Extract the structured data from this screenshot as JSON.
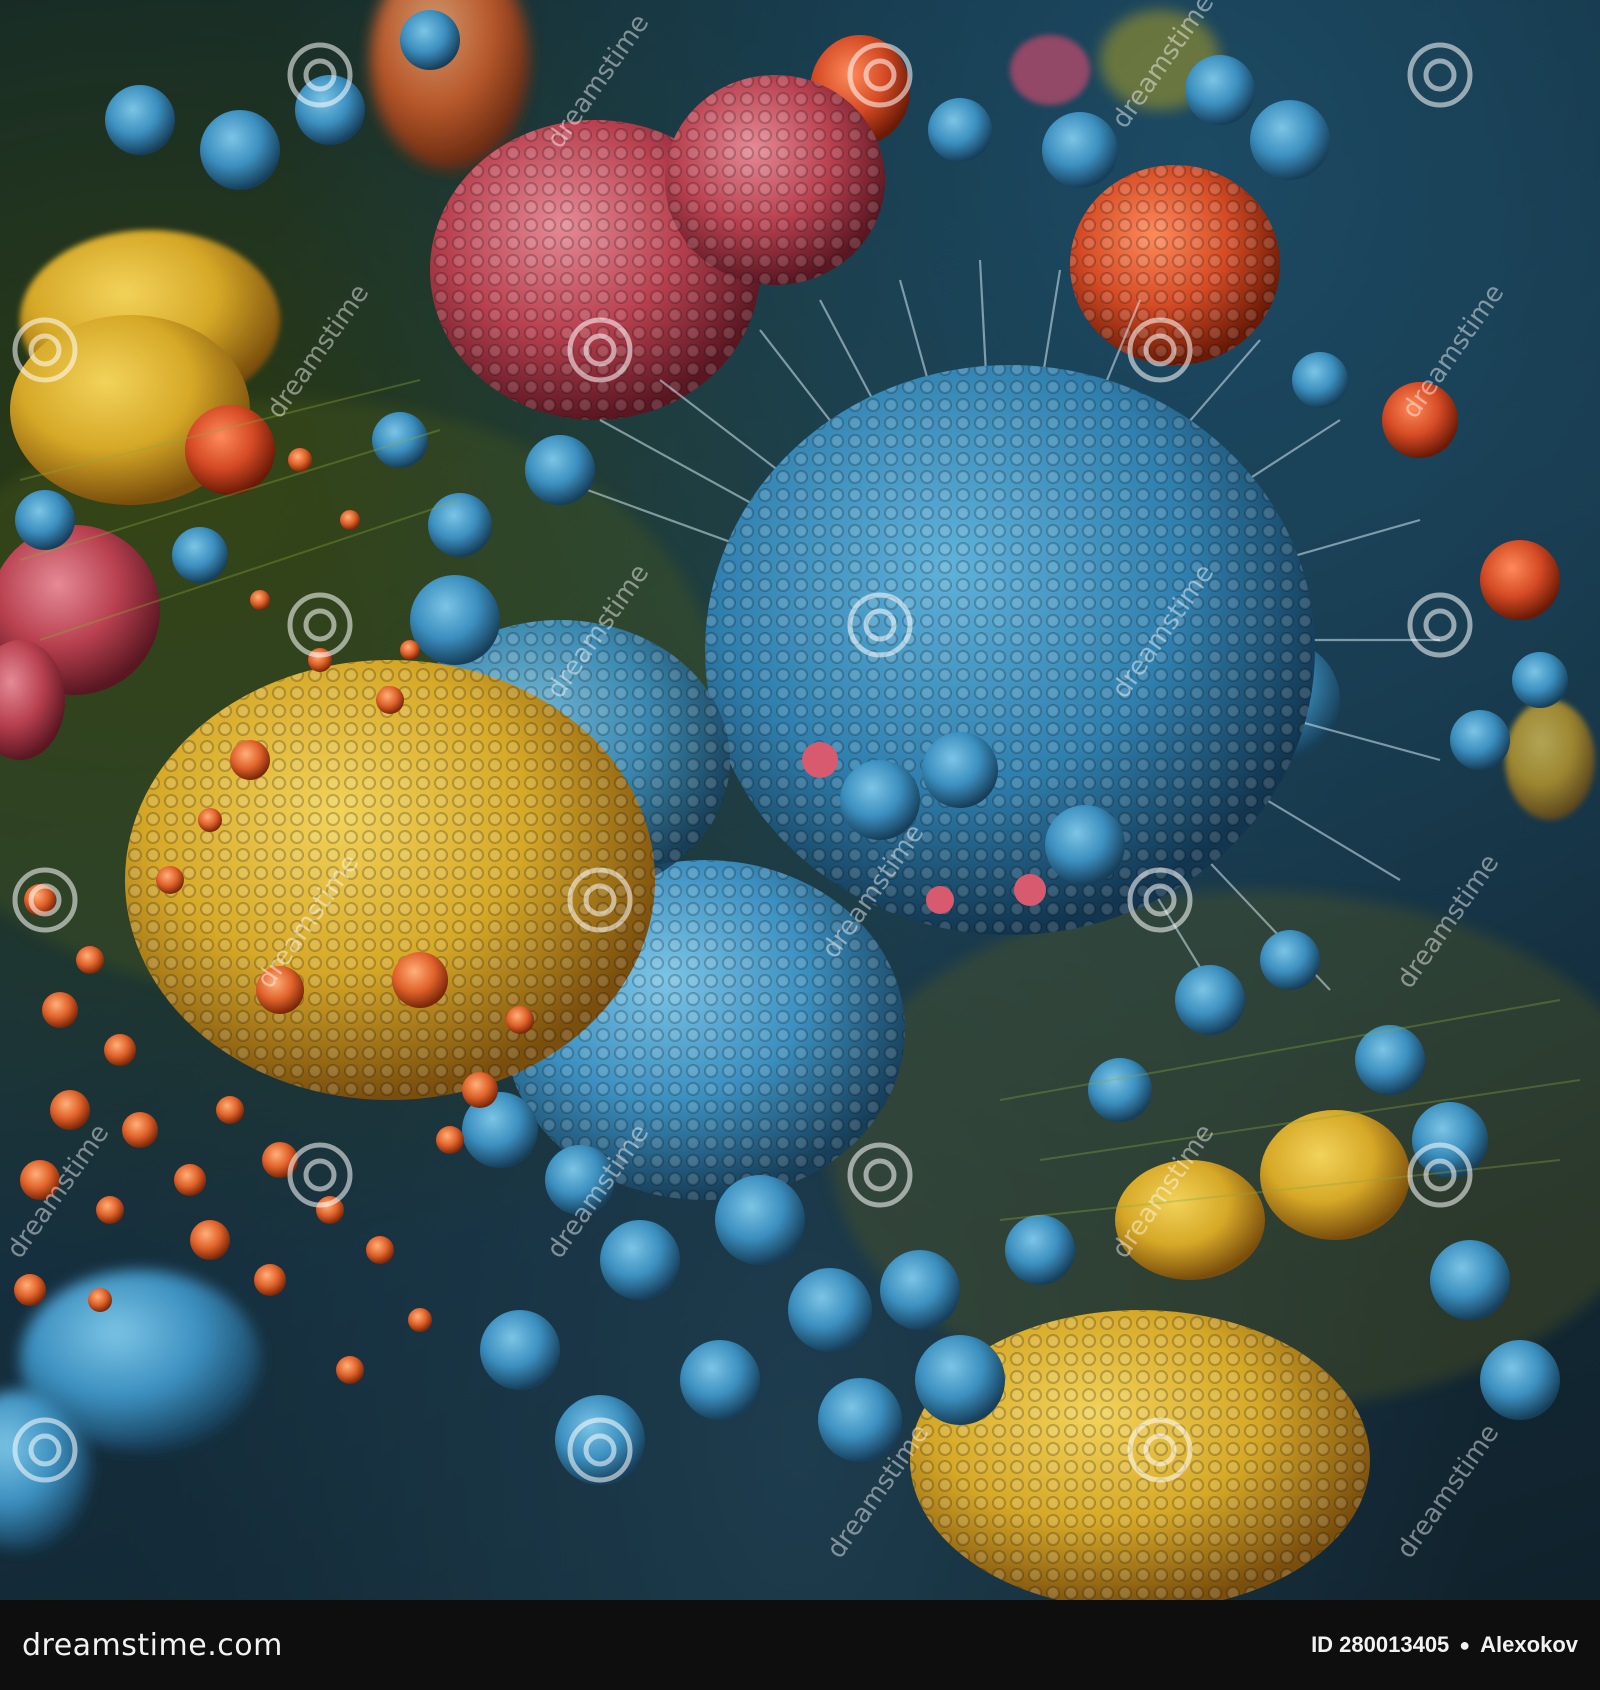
{
  "image": {
    "subject": "colorful microscopic cells",
    "palette": {
      "background": "#0d2431",
      "blue": "#3b8fbf",
      "red": "#b8404f",
      "yellow": "#d6a827",
      "orange": "#e0622a"
    }
  },
  "watermark": {
    "text": "dreamstime",
    "icon": "spiral-logo-icon"
  },
  "footer": {
    "brand": "dreamstime.com",
    "id_text": "ID 280013405",
    "author": "Alexokov",
    "separator": "●"
  }
}
